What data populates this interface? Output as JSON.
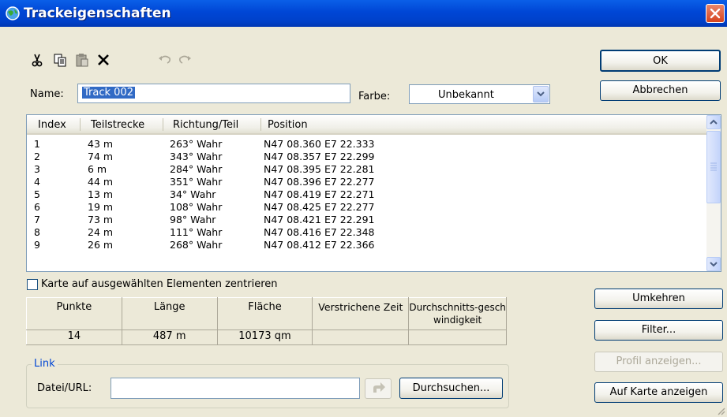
{
  "window": {
    "title": "Trackeigenschaften",
    "app_icon": "globe-icon",
    "close_icon": "close-icon"
  },
  "toolbar": {
    "items": [
      "cut-icon",
      "copy-icon",
      "paste-icon",
      "delete-icon",
      "undo-icon",
      "redo-icon"
    ]
  },
  "name": {
    "label": "Name:",
    "value": "Track 002"
  },
  "color": {
    "label": "Farbe:",
    "value": "Unbekannt"
  },
  "buttons": {
    "ok": "OK",
    "cancel": "Abbrechen",
    "reverse": "Umkehren",
    "filter": "Filter...",
    "profile": "Profil anzeigen...",
    "show_on_map": "Auf Karte anzeigen",
    "browse": "Durchsuchen..."
  },
  "table": {
    "columns": [
      "Index",
      "Teilstrecke",
      "Richtung/Teil",
      "Position"
    ],
    "rows": [
      [
        "1",
        "43 m",
        "263° Wahr",
        "N47 08.360 E7 22.333"
      ],
      [
        "2",
        "74 m",
        "343° Wahr",
        "N47 08.357 E7 22.299"
      ],
      [
        "3",
        "6 m",
        "284° Wahr",
        "N47 08.395 E7 22.281"
      ],
      [
        "4",
        "44 m",
        "351° Wahr",
        "N47 08.396 E7 22.277"
      ],
      [
        "5",
        "13 m",
        "34° Wahr",
        "N47 08.419 E7 22.271"
      ],
      [
        "6",
        "19 m",
        "108° Wahr",
        "N47 08.425 E7 22.277"
      ],
      [
        "7",
        "73 m",
        "98° Wahr",
        "N47 08.421 E7 22.291"
      ],
      [
        "8",
        "24 m",
        "111° Wahr",
        "N47 08.416 E7 22.348"
      ],
      [
        "9",
        "26 m",
        "268° Wahr",
        "N47 08.412 E7 22.366"
      ]
    ]
  },
  "center_checkbox": {
    "label": "Karte auf ausgewählten Elementen zentrieren",
    "checked": false
  },
  "stats": {
    "headers": [
      "Punkte",
      "Länge",
      "Fläche",
      "Verstrichene Zeit",
      "Durchschnitts-geschwindigkeit"
    ],
    "values": [
      "14",
      "487 m",
      "10173 qm",
      "",
      ""
    ]
  },
  "link": {
    "legend": "Link",
    "label": "Datei/URL:",
    "value": ""
  },
  "colors": {
    "titlebar": "#0A5FE8",
    "dialog_bg": "#ECE9D8",
    "selection": "#316AC5",
    "group_legend": "#0046D5"
  }
}
